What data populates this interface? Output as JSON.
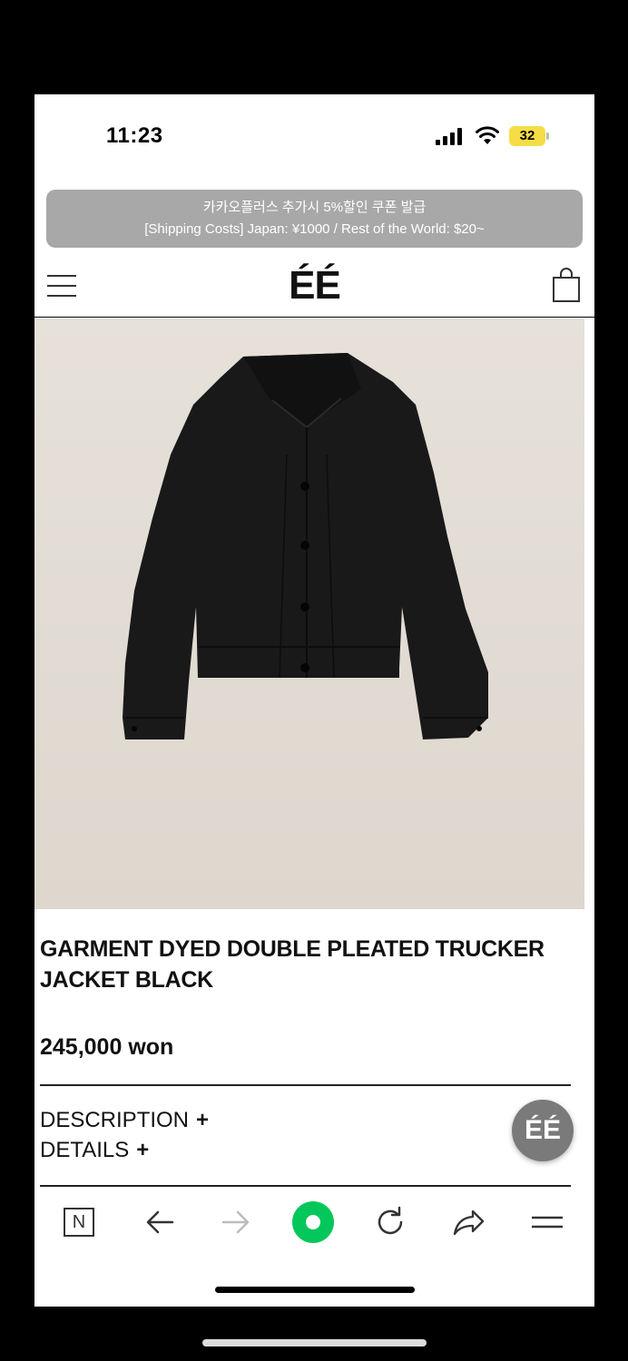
{
  "status": {
    "time": "11:23",
    "battery": "32"
  },
  "announcement": {
    "line1": "카카오플러스 추가시 5%할인 쿠폰 발급",
    "line2": "[Shipping Costs] Japan: ¥1000 / Rest of the World: $20~"
  },
  "header": {
    "logo": "ÉÉ"
  },
  "product": {
    "title": "GARMENT DYED DOUBLE PLEATED TRUCKER JACKET BLACK",
    "price": "245,000 won",
    "sections": [
      {
        "label": "DESCRIPTION",
        "icon": "+"
      },
      {
        "label": "DETAILS",
        "icon": "+"
      }
    ]
  },
  "floating_button": {
    "label": "ÉÉ"
  },
  "browser_bar": {
    "n_label": "N",
    "icons": [
      "n-icon",
      "back-arrow-icon",
      "forward-arrow-icon",
      "home-icon",
      "refresh-icon",
      "share-icon",
      "menu-icon"
    ]
  },
  "colors": {
    "announce_bg": "#a8a8a8",
    "battery": "#f6dd45",
    "home_green": "#03c75a",
    "image_bg": "#e5e0d8"
  }
}
